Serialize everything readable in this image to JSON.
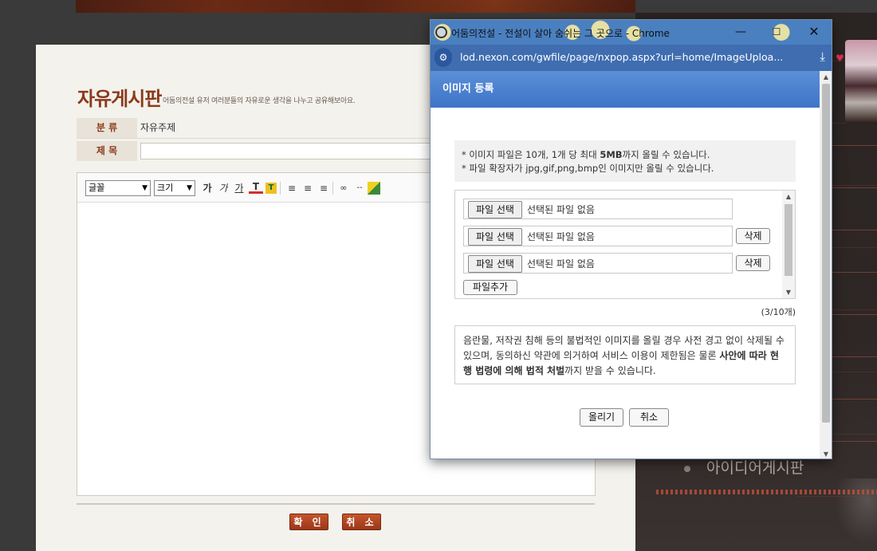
{
  "board": {
    "title": "자유게시판",
    "description": "어둠의전설 유저 여러분들의 자유로운 생각을 나누고 공유해보아요.",
    "category_label": "분 류",
    "category_value": "자유주제",
    "subject_label": "제 목",
    "subject_value": "",
    "font_select": "글꼴",
    "size_select": "크기",
    "confirm_label": "확 인",
    "cancel_label": "취 소"
  },
  "background_menu": {
    "item": "아이디어게시판"
  },
  "popup": {
    "window_title": "어둠의전설 - 전설이 살아 숨쉬는 그 곳으로 - Chrome",
    "url": "lod.nexon.com/gwfile/page/nxpop.aspx?url=home/ImageUploa...",
    "header": "이미지 등록",
    "notice_line1_pre": "이미지 파일은 10개, 1개 당 최대 ",
    "notice_line1_bold": "5MB",
    "notice_line1_post": "까지 올릴 수 있습니다.",
    "notice_line2": "파일 확장자가 jpg,gif,png,bmp인 이미지만 올릴 수 있습니다.",
    "file_button": "파일 선택",
    "no_file_text": "선택된 파일 없음",
    "delete_button": "삭제",
    "add_file_button": "파일추가",
    "count": "(3/10개)",
    "warning_pre": "음란물, 저작권 침해 등의 불법적인 이미지를 올릴 경우 사전 경고 없이 삭제될 수 있으며, 동의하신 약관에 의거하여 서비스 이용이 제한됨은 물론 ",
    "warning_bold": "사안에 따라 현행 법령에 의해 법적 처벌",
    "warning_post": "까지 받을 수 있습니다.",
    "upload_button": "올리기",
    "cancel_button": "취소"
  },
  "icons": {
    "minimize": "minimize-icon",
    "maximize": "maximize-icon",
    "close": "close-icon",
    "download": "download-icon",
    "site_info": "site-info-icon"
  }
}
